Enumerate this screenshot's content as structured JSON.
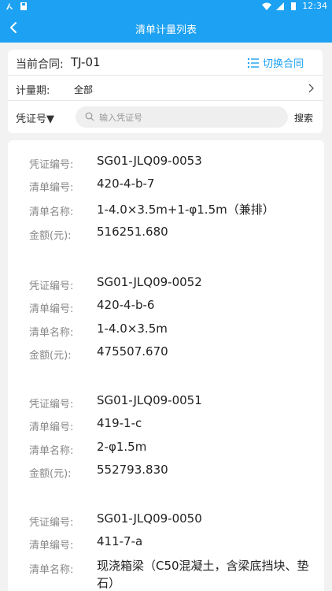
{
  "status": {
    "time": "12:34"
  },
  "nav": {
    "title": "清单计量列表"
  },
  "filter": {
    "contract_label": "当前合同:",
    "contract_value": "TJ-01",
    "switch_label": "切换合同",
    "period_label": "计量期:",
    "period_value": "全部",
    "voucher_label": "凭证号▼",
    "search_placeholder": "输入凭证号",
    "search_button": "搜索"
  },
  "labels": {
    "voucher_no": "凭证编号:",
    "item_no": "清单编号:",
    "item_name": "清单名称:",
    "amount": "金额(元):"
  },
  "items": [
    {
      "voucher_no": "SG01-JLQ09-0053",
      "item_no": "420-4-b-7",
      "item_name": "1-4.0×3.5m+1-φ1.5m（兼排）",
      "amount": "516251.680"
    },
    {
      "voucher_no": "SG01-JLQ09-0052",
      "item_no": "420-4-b-6",
      "item_name": "1-4.0×3.5m",
      "amount": "475507.670"
    },
    {
      "voucher_no": "SG01-JLQ09-0051",
      "item_no": "419-1-c",
      "item_name": "2-φ1.5m",
      "amount": "552793.830"
    },
    {
      "voucher_no": "SG01-JLQ09-0050",
      "item_no": "411-7-a",
      "item_name": "现浇箱梁（C50混凝土，含梁底挡块、垫石）",
      "amount": ""
    }
  ]
}
